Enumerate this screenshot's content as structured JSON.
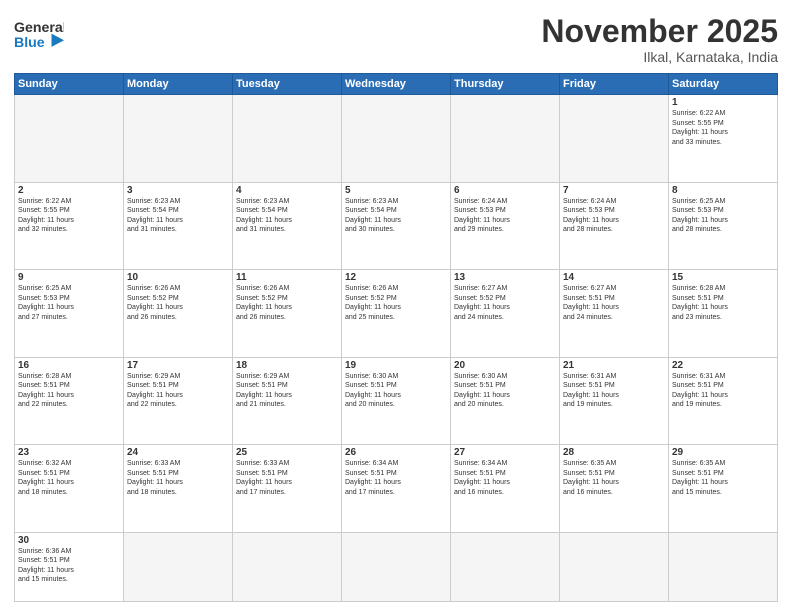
{
  "header": {
    "logo_general": "General",
    "logo_blue": "Blue",
    "month_title": "November 2025",
    "location": "Ilkal, Karnataka, India"
  },
  "days_of_week": [
    "Sunday",
    "Monday",
    "Tuesday",
    "Wednesday",
    "Thursday",
    "Friday",
    "Saturday"
  ],
  "weeks": [
    [
      {
        "day": "",
        "info": ""
      },
      {
        "day": "",
        "info": ""
      },
      {
        "day": "",
        "info": ""
      },
      {
        "day": "",
        "info": ""
      },
      {
        "day": "",
        "info": ""
      },
      {
        "day": "",
        "info": ""
      },
      {
        "day": "1",
        "info": "Sunrise: 6:22 AM\nSunset: 5:55 PM\nDaylight: 11 hours\nand 33 minutes."
      }
    ],
    [
      {
        "day": "2",
        "info": "Sunrise: 6:22 AM\nSunset: 5:55 PM\nDaylight: 11 hours\nand 32 minutes."
      },
      {
        "day": "3",
        "info": "Sunrise: 6:23 AM\nSunset: 5:54 PM\nDaylight: 11 hours\nand 31 minutes."
      },
      {
        "day": "4",
        "info": "Sunrise: 6:23 AM\nSunset: 5:54 PM\nDaylight: 11 hours\nand 31 minutes."
      },
      {
        "day": "5",
        "info": "Sunrise: 6:23 AM\nSunset: 5:54 PM\nDaylight: 11 hours\nand 30 minutes."
      },
      {
        "day": "6",
        "info": "Sunrise: 6:24 AM\nSunset: 5:53 PM\nDaylight: 11 hours\nand 29 minutes."
      },
      {
        "day": "7",
        "info": "Sunrise: 6:24 AM\nSunset: 5:53 PM\nDaylight: 11 hours\nand 28 minutes."
      },
      {
        "day": "8",
        "info": "Sunrise: 6:25 AM\nSunset: 5:53 PM\nDaylight: 11 hours\nand 28 minutes."
      }
    ],
    [
      {
        "day": "9",
        "info": "Sunrise: 6:25 AM\nSunset: 5:53 PM\nDaylight: 11 hours\nand 27 minutes."
      },
      {
        "day": "10",
        "info": "Sunrise: 6:26 AM\nSunset: 5:52 PM\nDaylight: 11 hours\nand 26 minutes."
      },
      {
        "day": "11",
        "info": "Sunrise: 6:26 AM\nSunset: 5:52 PM\nDaylight: 11 hours\nand 26 minutes."
      },
      {
        "day": "12",
        "info": "Sunrise: 6:26 AM\nSunset: 5:52 PM\nDaylight: 11 hours\nand 25 minutes."
      },
      {
        "day": "13",
        "info": "Sunrise: 6:27 AM\nSunset: 5:52 PM\nDaylight: 11 hours\nand 24 minutes."
      },
      {
        "day": "14",
        "info": "Sunrise: 6:27 AM\nSunset: 5:51 PM\nDaylight: 11 hours\nand 24 minutes."
      },
      {
        "day": "15",
        "info": "Sunrise: 6:28 AM\nSunset: 5:51 PM\nDaylight: 11 hours\nand 23 minutes."
      }
    ],
    [
      {
        "day": "16",
        "info": "Sunrise: 6:28 AM\nSunset: 5:51 PM\nDaylight: 11 hours\nand 22 minutes."
      },
      {
        "day": "17",
        "info": "Sunrise: 6:29 AM\nSunset: 5:51 PM\nDaylight: 11 hours\nand 22 minutes."
      },
      {
        "day": "18",
        "info": "Sunrise: 6:29 AM\nSunset: 5:51 PM\nDaylight: 11 hours\nand 21 minutes."
      },
      {
        "day": "19",
        "info": "Sunrise: 6:30 AM\nSunset: 5:51 PM\nDaylight: 11 hours\nand 20 minutes."
      },
      {
        "day": "20",
        "info": "Sunrise: 6:30 AM\nSunset: 5:51 PM\nDaylight: 11 hours\nand 20 minutes."
      },
      {
        "day": "21",
        "info": "Sunrise: 6:31 AM\nSunset: 5:51 PM\nDaylight: 11 hours\nand 19 minutes."
      },
      {
        "day": "22",
        "info": "Sunrise: 6:31 AM\nSunset: 5:51 PM\nDaylight: 11 hours\nand 19 minutes."
      }
    ],
    [
      {
        "day": "23",
        "info": "Sunrise: 6:32 AM\nSunset: 5:51 PM\nDaylight: 11 hours\nand 18 minutes."
      },
      {
        "day": "24",
        "info": "Sunrise: 6:33 AM\nSunset: 5:51 PM\nDaylight: 11 hours\nand 18 minutes."
      },
      {
        "day": "25",
        "info": "Sunrise: 6:33 AM\nSunset: 5:51 PM\nDaylight: 11 hours\nand 17 minutes."
      },
      {
        "day": "26",
        "info": "Sunrise: 6:34 AM\nSunset: 5:51 PM\nDaylight: 11 hours\nand 17 minutes."
      },
      {
        "day": "27",
        "info": "Sunrise: 6:34 AM\nSunset: 5:51 PM\nDaylight: 11 hours\nand 16 minutes."
      },
      {
        "day": "28",
        "info": "Sunrise: 6:35 AM\nSunset: 5:51 PM\nDaylight: 11 hours\nand 16 minutes."
      },
      {
        "day": "29",
        "info": "Sunrise: 6:35 AM\nSunset: 5:51 PM\nDaylight: 11 hours\nand 15 minutes."
      }
    ],
    [
      {
        "day": "30",
        "info": "Sunrise: 6:36 AM\nSunset: 5:51 PM\nDaylight: 11 hours\nand 15 minutes."
      },
      {
        "day": "",
        "info": ""
      },
      {
        "day": "",
        "info": ""
      },
      {
        "day": "",
        "info": ""
      },
      {
        "day": "",
        "info": ""
      },
      {
        "day": "",
        "info": ""
      },
      {
        "day": "",
        "info": ""
      }
    ]
  ]
}
